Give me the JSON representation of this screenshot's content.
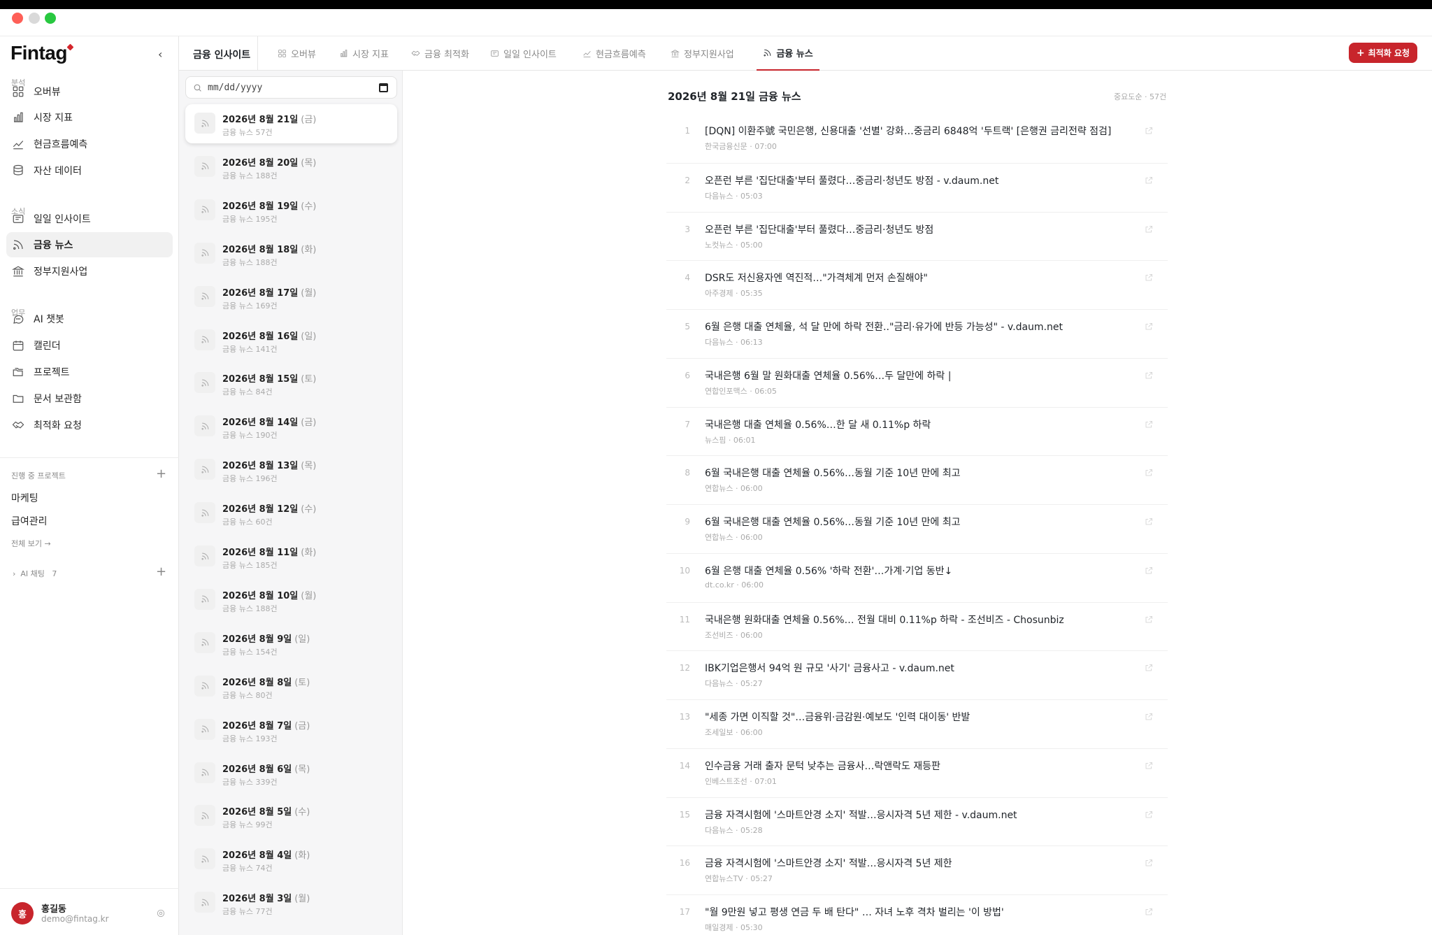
{
  "brand": {
    "name": "Fintag",
    "accent": "#c8252c"
  },
  "sidebar": {
    "collapse_icon": "chevron-left-icon",
    "sections": [
      {
        "label": "분석",
        "items": [
          {
            "label": "오버뷰",
            "icon": "grid-icon"
          },
          {
            "label": "시장 지표",
            "icon": "bar-chart-icon"
          },
          {
            "label": "현금흐름예측",
            "icon": "trend-line-icon"
          },
          {
            "label": "자산 데이터",
            "icon": "database-icon"
          }
        ]
      },
      {
        "label": "소식",
        "items": [
          {
            "label": "일일 인사이트",
            "icon": "newspaper-icon"
          },
          {
            "label": "금융 뉴스",
            "icon": "rss-icon",
            "active": true
          },
          {
            "label": "정부지원사업",
            "icon": "bank-icon"
          }
        ]
      },
      {
        "label": "업무",
        "items": [
          {
            "label": "AI 챗봇",
            "icon": "chat-bubble-icon"
          },
          {
            "label": "캘린더",
            "icon": "calendar-icon"
          },
          {
            "label": "프로젝트",
            "icon": "folders-icon"
          },
          {
            "label": "문서 보관함",
            "icon": "folder-icon"
          },
          {
            "label": "최적화 요청",
            "icon": "handshake-icon"
          }
        ]
      }
    ],
    "projects_label": "진행 중 프로젝트",
    "projects": [
      "마케팅",
      "급여관리"
    ],
    "see_all": "전체 보기 →",
    "ai_chat_label": "AI 채팅",
    "ai_chat_count": "7",
    "user": {
      "initial": "홍",
      "name": "홍길동",
      "email": "demo@fintag.kr"
    }
  },
  "header": {
    "section_title": "금융 인사이트",
    "tabs": [
      {
        "label": "오버뷰",
        "icon": "grid-icon"
      },
      {
        "label": "시장 지표",
        "icon": "bar-chart-icon"
      },
      {
        "label": "금융 최적화",
        "icon": "handshake-icon"
      },
      {
        "label": "일일 인사이트",
        "icon": "newspaper-icon"
      },
      {
        "label": "현금흐름예측",
        "icon": "trend-line-icon"
      },
      {
        "label": "정부지원사업",
        "icon": "bank-icon"
      },
      {
        "label": "금융 뉴스",
        "icon": "rss-icon",
        "active": true
      }
    ],
    "cta_label": "최적화 요청"
  },
  "date_panel": {
    "placeholder": "mm/dd/yyyy",
    "items": [
      {
        "date": "2026년 8월 21일",
        "dow": "(금)",
        "count": "금융 뉴스 57건",
        "selected": true
      },
      {
        "date": "2026년 8월 20일",
        "dow": "(목)",
        "count": "금융 뉴스 188건"
      },
      {
        "date": "2026년 8월 19일",
        "dow": "(수)",
        "count": "금융 뉴스 195건"
      },
      {
        "date": "2026년 8월 18일",
        "dow": "(화)",
        "count": "금융 뉴스 188건"
      },
      {
        "date": "2026년 8월 17일",
        "dow": "(월)",
        "count": "금융 뉴스 169건"
      },
      {
        "date": "2026년 8월 16일",
        "dow": "(일)",
        "count": "금융 뉴스 141건"
      },
      {
        "date": "2026년 8월 15일",
        "dow": "(토)",
        "count": "금융 뉴스 84건"
      },
      {
        "date": "2026년 8월 14일",
        "dow": "(금)",
        "count": "금융 뉴스 190건"
      },
      {
        "date": "2026년 8월 13일",
        "dow": "(목)",
        "count": "금융 뉴스 196건"
      },
      {
        "date": "2026년 8월 12일",
        "dow": "(수)",
        "count": "금융 뉴스 60건"
      },
      {
        "date": "2026년 8월 11일",
        "dow": "(화)",
        "count": "금융 뉴스 185건"
      },
      {
        "date": "2026년 8월 10일",
        "dow": "(월)",
        "count": "금융 뉴스 188건"
      },
      {
        "date": "2026년 8월 9일",
        "dow": "(일)",
        "count": "금융 뉴스 154건"
      },
      {
        "date": "2026년 8월 8일",
        "dow": "(토)",
        "count": "금융 뉴스 80건"
      },
      {
        "date": "2026년 8월 7일",
        "dow": "(금)",
        "count": "금융 뉴스 193건"
      },
      {
        "date": "2026년 8월 6일",
        "dow": "(목)",
        "count": "금융 뉴스 339건"
      },
      {
        "date": "2026년 8월 5일",
        "dow": "(수)",
        "count": "금융 뉴스 99건"
      },
      {
        "date": "2026년 8월 4일",
        "dow": "(화)",
        "count": "금융 뉴스 74건"
      },
      {
        "date": "2026년 8월 3일",
        "dow": "(월)",
        "count": "금융 뉴스 77건"
      }
    ]
  },
  "news": {
    "title": "2026년 8월 21일 금융 뉴스",
    "meta": "중요도순 · 57건",
    "items": [
      {
        "n": "1",
        "title": "[DQN] 이환주號 국민은행, 신용대출 '선별' 강화…중금리 6848억 '두트랙' [은행권 금리전략 점검]",
        "meta": "한국금융신문 · 07:00"
      },
      {
        "n": "2",
        "title": "오픈런 부른 '집단대출'부터 풀렸다…중금리·청년도 방점 - v.daum.net",
        "meta": "다음뉴스 · 05:03"
      },
      {
        "n": "3",
        "title": "오픈런 부른 '집단대출'부터 풀렸다…중금리·청년도 방점",
        "meta": "노컷뉴스 · 05:00"
      },
      {
        "n": "4",
        "title": "DSR도 저신용자엔 역진적…\"가격체계 먼저 손질해야\"",
        "meta": "아주경제 · 05:35"
      },
      {
        "n": "5",
        "title": "6월 은행 대출 연체율, 석 달 만에 하락 전환..\"금리·유가에 반등 가능성\" - v.daum.net",
        "meta": "다음뉴스 · 06:13"
      },
      {
        "n": "6",
        "title": "국내은행 6월 말 원화대출 연체율 0.56%…두 달만에 하락 |",
        "meta": "연합인포맥스 · 06:05"
      },
      {
        "n": "7",
        "title": "국내은행 대출 연체율 0.56%…한 달 새 0.11%p 하락",
        "meta": "뉴스핌 · 06:01"
      },
      {
        "n": "8",
        "title": "6월 국내은행 대출 연체율 0.56%…동월 기준 10년 만에 최고",
        "meta": "연합뉴스 · 06:00"
      },
      {
        "n": "9",
        "title": "6월 국내은행 대출 연체율 0.56%…동월 기준 10년 만에 최고",
        "meta": "연합뉴스 · 06:00"
      },
      {
        "n": "10",
        "title": "6월 은행 대출 연체율 0.56% '하락 전환'…가계·기업 동반↓",
        "meta": "dt.co.kr · 06:00"
      },
      {
        "n": "11",
        "title": "국내은행 원화대출 연체율 0.56%… 전월 대비 0.11%p 하락 - 조선비즈 - Chosunbiz",
        "meta": "조선비즈 · 06:00"
      },
      {
        "n": "12",
        "title": "IBK기업은행서 94억 원 규모 '사기' 금융사고 - v.daum.net",
        "meta": "다음뉴스 · 05:27"
      },
      {
        "n": "13",
        "title": "\"세종 가면 이직할 것\"…금융위·금감원·예보도 '인력 대이동' 반발",
        "meta": "조세일보 · 06:00"
      },
      {
        "n": "14",
        "title": "인수금융 거래 출자 문턱 낮추는 금융사…락앤락도 재등판",
        "meta": "인베스트조선 · 07:01"
      },
      {
        "n": "15",
        "title": "금융 자격시험에 '스마트안경 소지' 적발…응시자격 5년 제한 - v.daum.net",
        "meta": "다음뉴스 · 05:28"
      },
      {
        "n": "16",
        "title": "금융 자격시험에 '스마트안경 소지' 적발…응시자격 5년 제한",
        "meta": "연합뉴스TV · 05:27"
      },
      {
        "n": "17",
        "title": "\"월 9만원 넣고 평생 연금 두 배 탄다\" … 자녀 노후 격차 벌리는 '이 방법'",
        "meta": "매일경제 · 05:30"
      }
    ]
  }
}
